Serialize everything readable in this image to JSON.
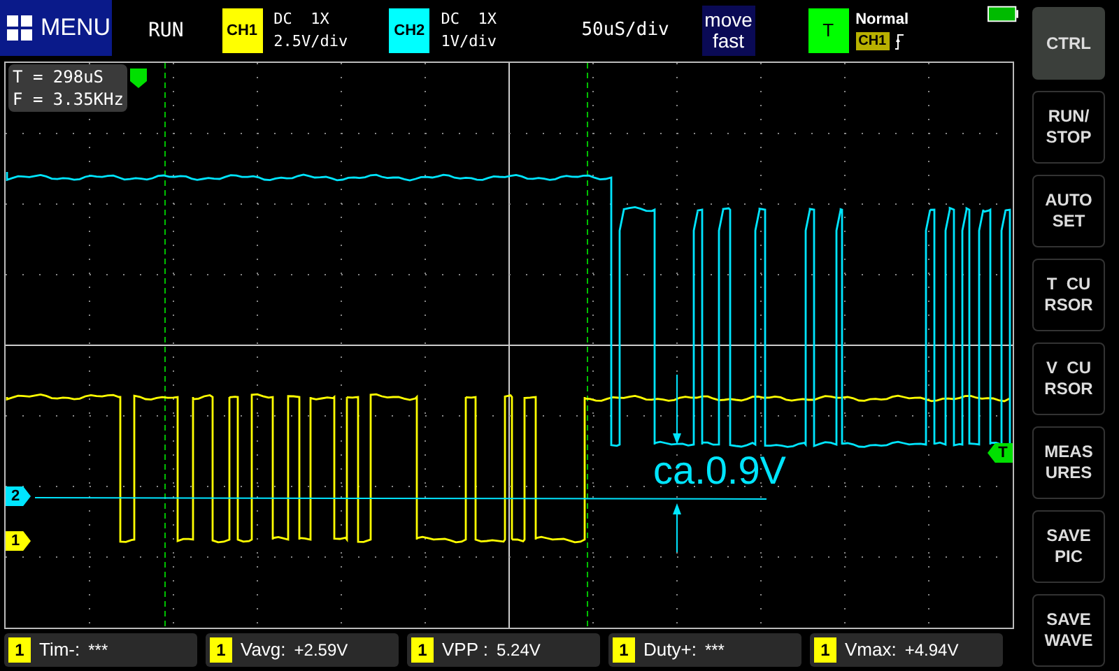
{
  "menu_button": {
    "label": "MENU"
  },
  "run_state": "RUN",
  "channels": [
    {
      "badge": "CH1",
      "color": "#ffff00",
      "coupling": "DC  1X",
      "scale": "2.5V/div"
    },
    {
      "badge": "CH2",
      "color": "#00ffff",
      "coupling": "DC  1X",
      "scale": "1V/div"
    }
  ],
  "timebase": "50uS/div",
  "move_mode": {
    "lines": [
      "move",
      "fast"
    ]
  },
  "trigger": {
    "badge": "T",
    "mode": "Normal",
    "source": "CH1"
  },
  "cursor_readout": [
    "T = 298uS",
    "F = 3.35KHz"
  ],
  "markers": [
    {
      "kind": "channel",
      "label": "2",
      "color": "#00e5ff"
    },
    {
      "kind": "channel",
      "label": "1",
      "color": "#ffff00"
    },
    {
      "kind": "trigger",
      "label": "T",
      "color": "#00e000"
    }
  ],
  "annotation": "ca.0.9V",
  "side_buttons": [
    {
      "lines": [
        "CTRL"
      ],
      "selected": true
    },
    {
      "lines": [
        "RUN/",
        "STOP"
      ],
      "selected": false
    },
    {
      "lines": [
        "AUTO",
        "SET"
      ],
      "selected": false
    },
    {
      "lines": [
        "T  CU",
        "RSOR"
      ],
      "selected": false
    },
    {
      "lines": [
        "V  CU",
        "RSOR"
      ],
      "selected": false
    },
    {
      "lines": [
        "MEAS",
        "URES"
      ],
      "selected": false
    },
    {
      "lines": [
        "SAVE",
        "PIC"
      ],
      "selected": false
    },
    {
      "lines": [
        "SAVE",
        "WAVE"
      ],
      "selected": false
    }
  ],
  "measurements": [
    {
      "channel": "1",
      "label": "Tim-:",
      "value": "***"
    },
    {
      "channel": "1",
      "label": "Vavg:",
      "value": "+2.59V"
    },
    {
      "channel": "1",
      "label": "VPP :",
      "value": "5.24V"
    },
    {
      "channel": "1",
      "label": "Duty+:",
      "value": "***"
    },
    {
      "channel": "1",
      "label": "Vmax:",
      "value": "+4.94V"
    }
  ]
}
